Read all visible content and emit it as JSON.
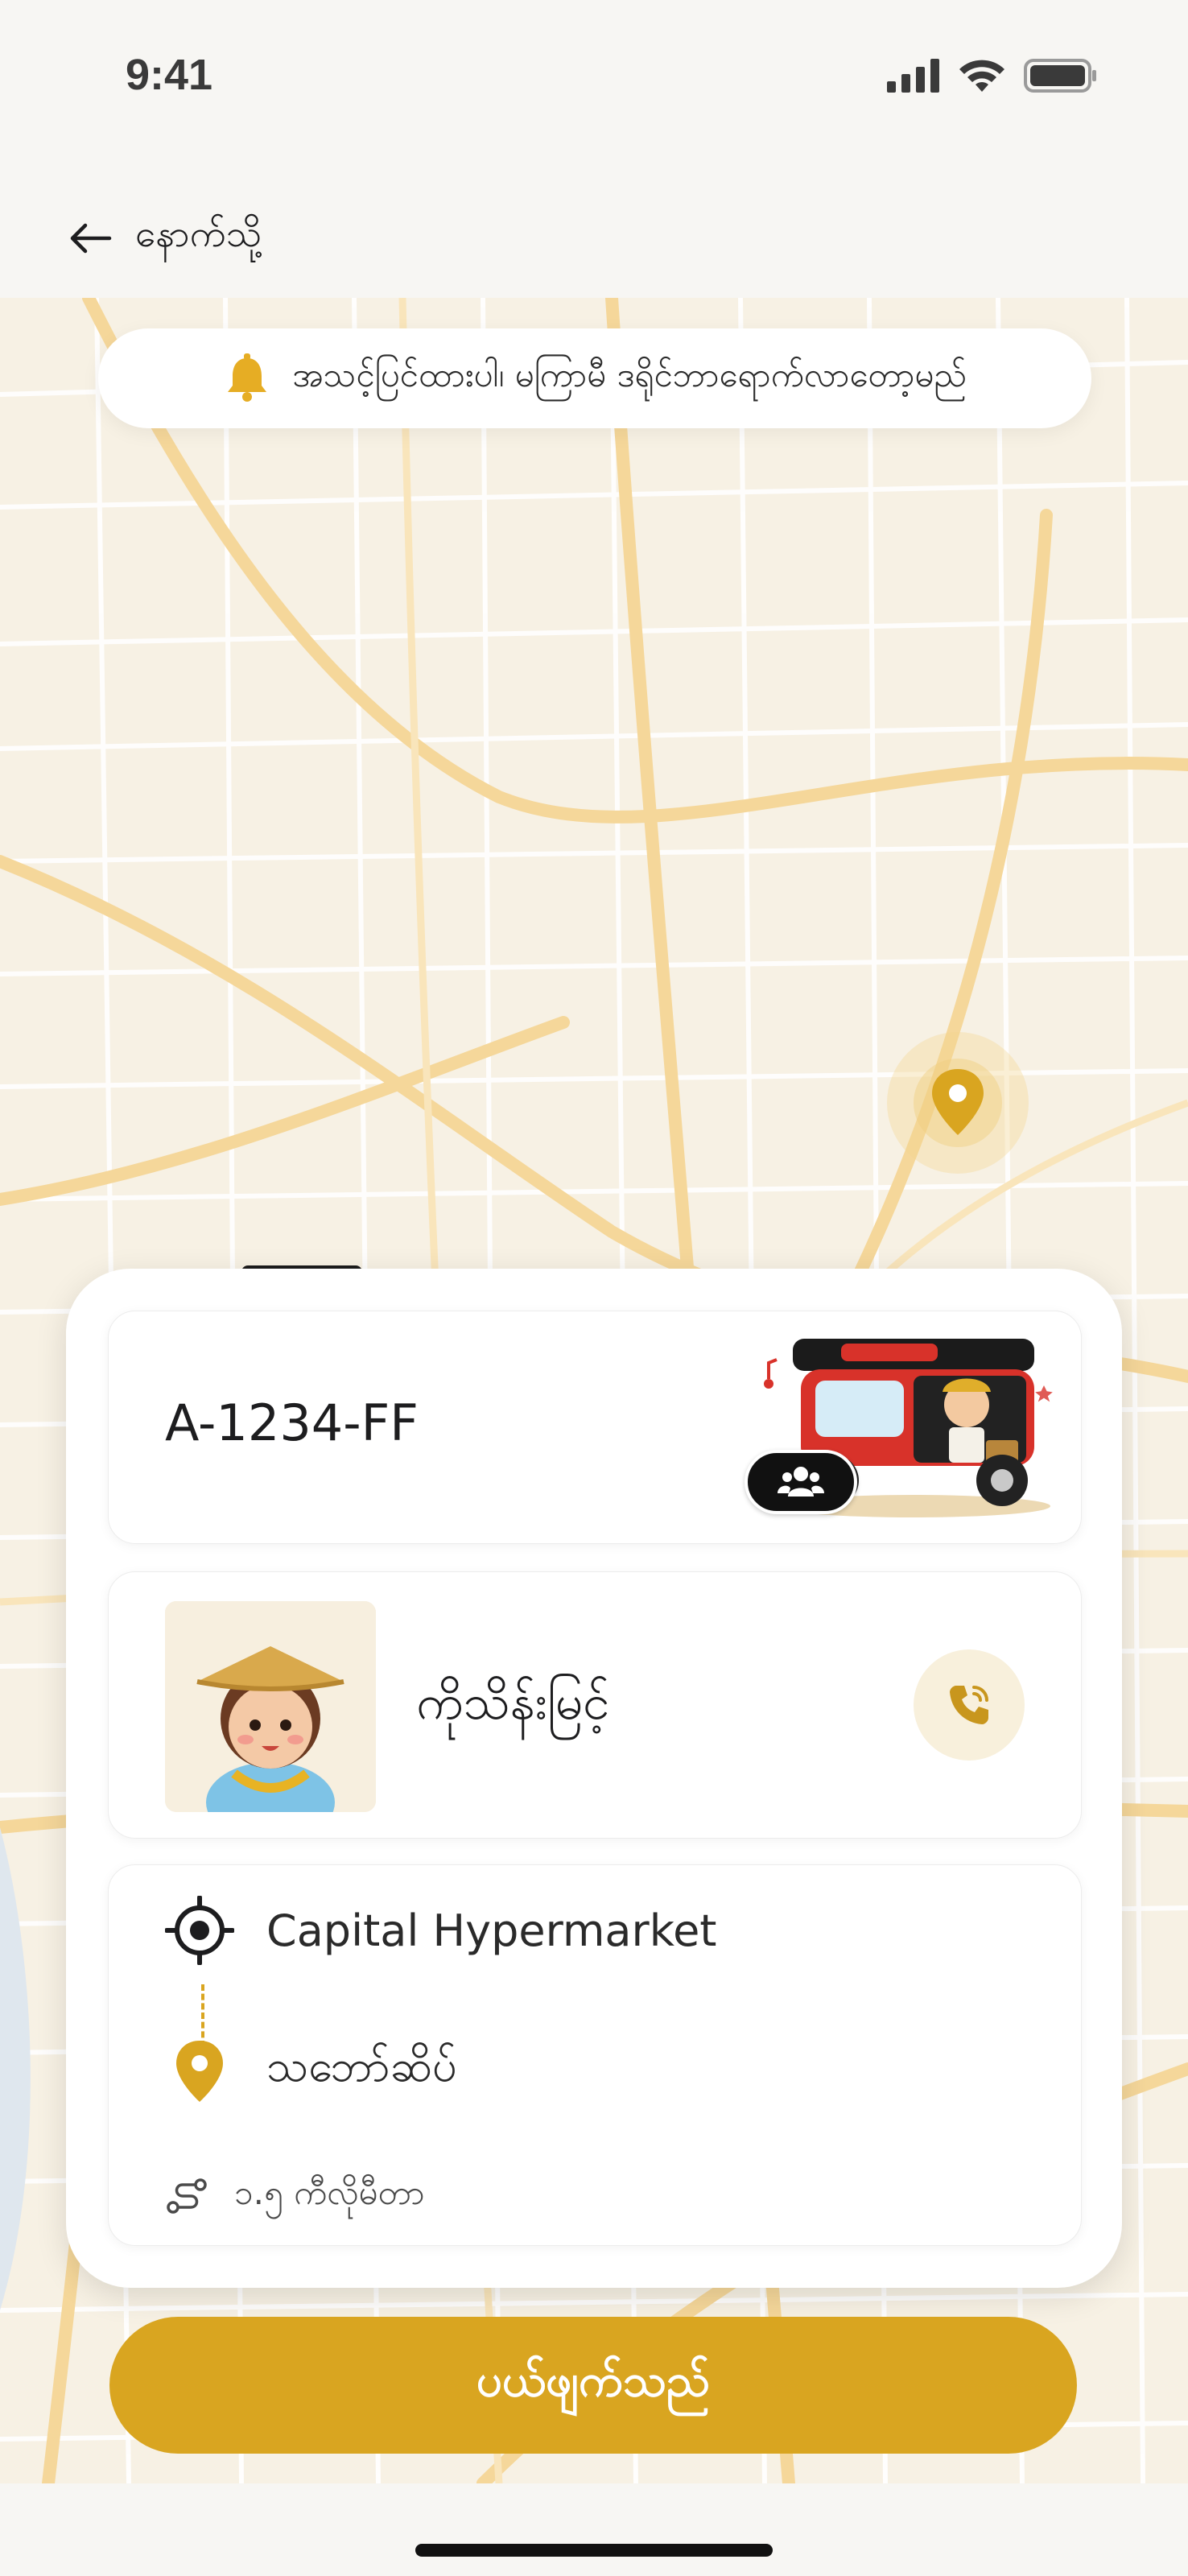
{
  "status_bar": {
    "time": "9:41"
  },
  "header": {
    "back_label": "နောက်သို့"
  },
  "map": {
    "notice": "အသင့်ပြင်ထားပါ၊ မကြာမီ ဒရိုင်ဘာရောက်လာတော့မည်"
  },
  "trip": {
    "plate": "A-1234-FF",
    "driver_name": "ကိုသိန်းမြင့်",
    "pickup": "Capital Hypermarket",
    "dropoff": "သဘော်ဆိပ်",
    "distance": "၁.၅ ကီလိုမီတာ"
  },
  "actions": {
    "cancel_label": "ပယ်ဖျက်သည်"
  },
  "colors": {
    "accent": "#d9a520",
    "map_bg": "#f7f1e4",
    "road": "#f5d79a"
  },
  "icons": {
    "back": "arrow-left-icon",
    "bell": "bell-icon",
    "pin": "location-pin-icon",
    "pickup": "crosshair-icon",
    "phone": "phone-icon",
    "share": "users-icon",
    "route": "route-icon"
  }
}
